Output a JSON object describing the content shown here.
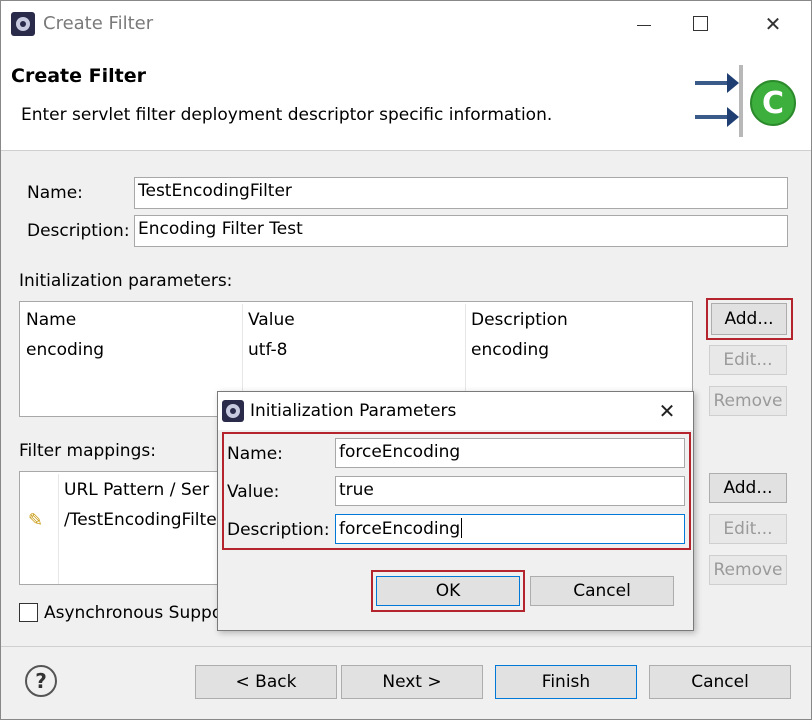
{
  "window": {
    "title": "Create Filter",
    "header_title": "Create Filter",
    "header_message": "Enter servlet filter deployment descriptor specific information."
  },
  "form": {
    "name_label": "Name:",
    "name_value": "TestEncodingFilter",
    "description_label": "Description:",
    "description_value": "Encoding Filter Test"
  },
  "init_params": {
    "label": "Initialization parameters:",
    "columns": [
      "Name",
      "Value",
      "Description"
    ],
    "rows": [
      {
        "name": "encoding",
        "value": "utf-8",
        "description": "encoding"
      }
    ],
    "buttons": {
      "add": "Add...",
      "edit": "Edit...",
      "remove": "Remove"
    }
  },
  "filter_mappings": {
    "label": "Filter mappings:",
    "header": "URL Pattern / Ser",
    "row": "/TestEncodingFilte",
    "buttons": {
      "add": "Add...",
      "edit": "Edit...",
      "remove": "Remove"
    }
  },
  "async": {
    "label": "Asynchronous Suppo",
    "checked": false
  },
  "footer": {
    "help": "?",
    "back": "< Back",
    "next": "Next >",
    "finish": "Finish",
    "cancel": "Cancel"
  },
  "dialog": {
    "title": "Initialization Parameters",
    "name_label": "Name:",
    "name_value": "forceEncoding",
    "value_label": "Value:",
    "value_value": "true",
    "description_label": "Description:",
    "description_value": "forceEncoding",
    "ok": "OK",
    "cancel": "Cancel"
  },
  "colors": {
    "highlight": "#b3242c",
    "focus": "#0078d7"
  }
}
